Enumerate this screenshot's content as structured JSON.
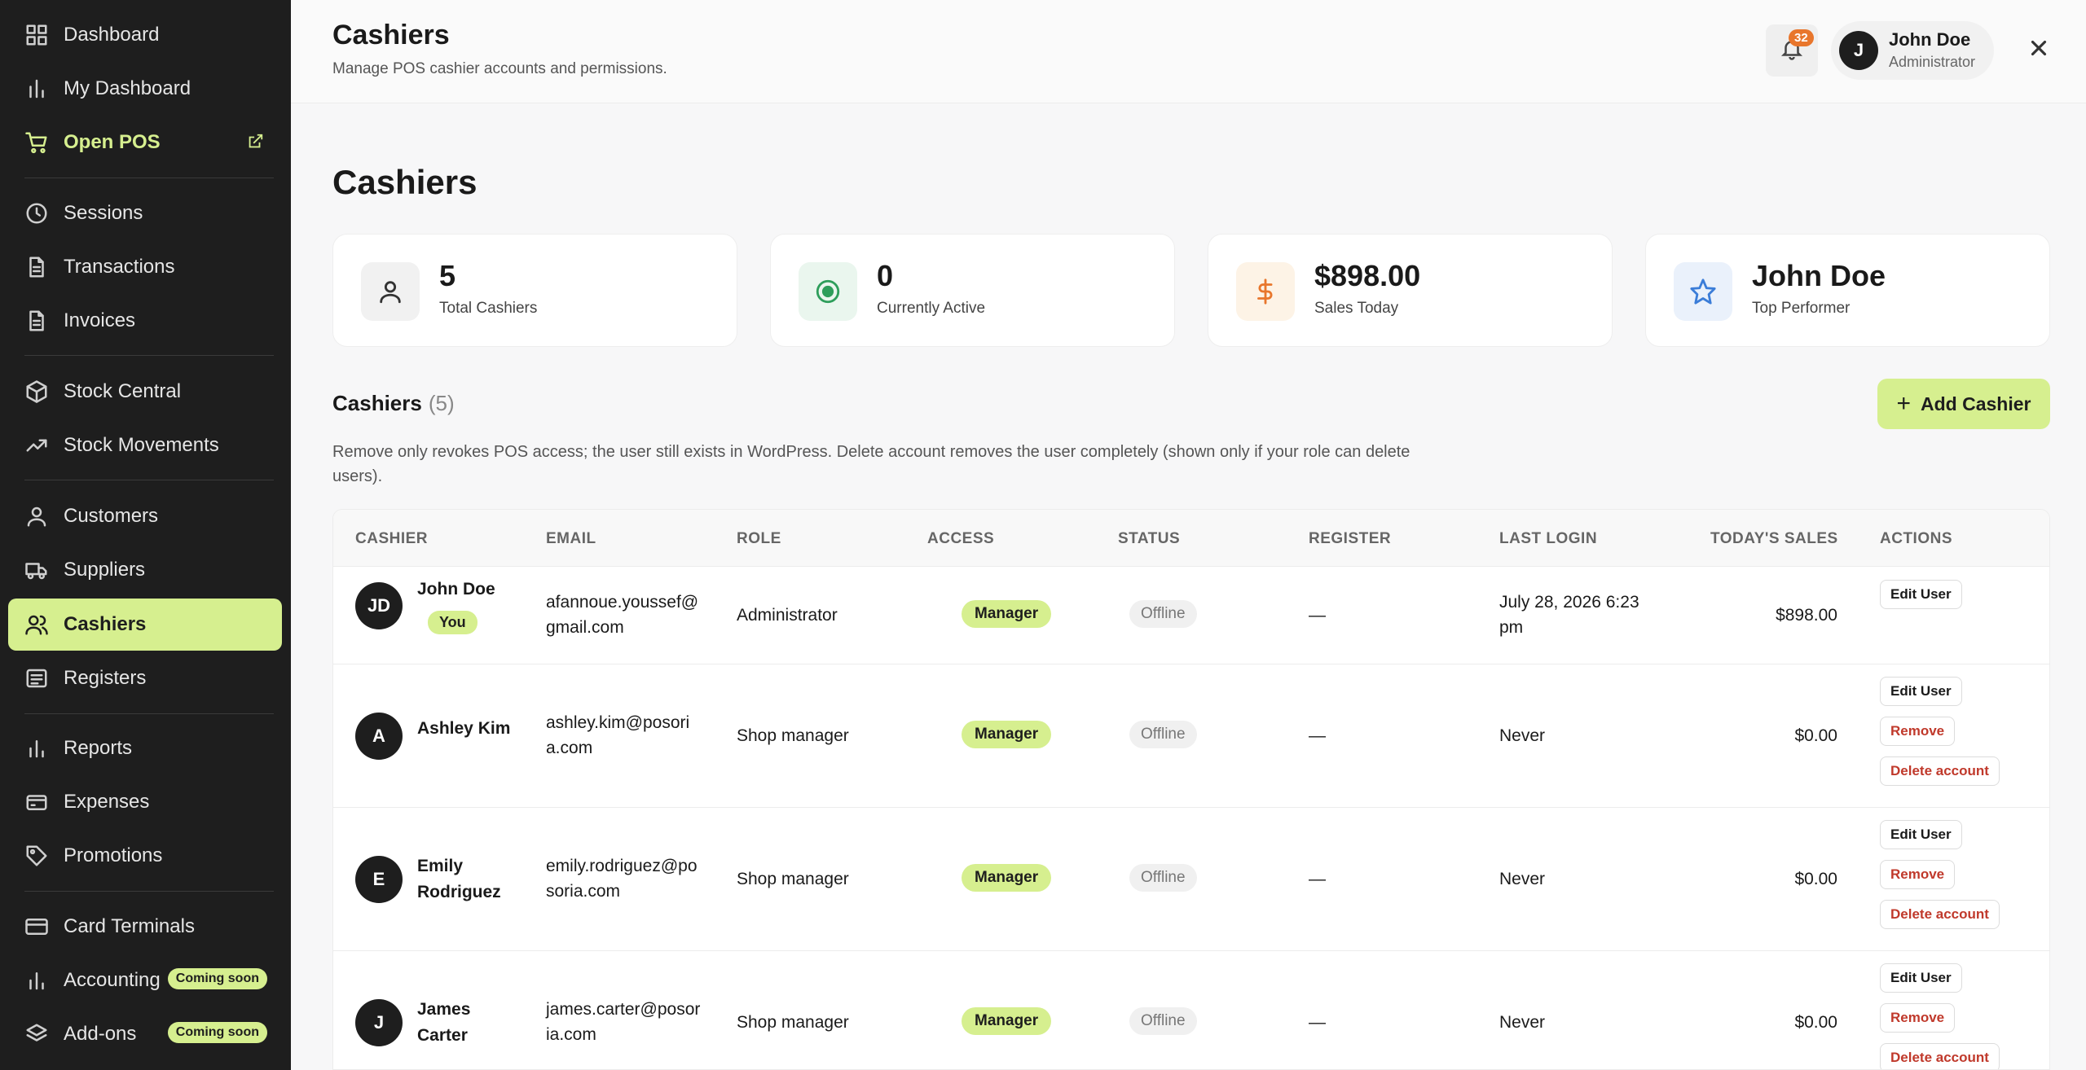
{
  "sidebar": {
    "items": [
      {
        "label": "Dashboard",
        "icon": "grid-icon"
      },
      {
        "label": "My Dashboard",
        "icon": "bar-chart-icon"
      },
      {
        "label": "Open POS",
        "icon": "cart-icon"
      },
      {
        "label": "Sessions",
        "icon": "clock-icon"
      },
      {
        "label": "Transactions",
        "icon": "file-icon"
      },
      {
        "label": "Invoices",
        "icon": "file-icon"
      },
      {
        "label": "Stock Central",
        "icon": "box-icon"
      },
      {
        "label": "Stock Movements",
        "icon": "trending-up-icon"
      },
      {
        "label": "Customers",
        "icon": "user-icon"
      },
      {
        "label": "Suppliers",
        "icon": "truck-icon"
      },
      {
        "label": "Cashiers",
        "icon": "users-icon"
      },
      {
        "label": "Registers",
        "icon": "list-icon"
      },
      {
        "label": "Reports",
        "icon": "bar-chart-icon"
      },
      {
        "label": "Expenses",
        "icon": "wallet-icon"
      },
      {
        "label": "Promotions",
        "icon": "tag-icon"
      },
      {
        "label": "Card Terminals",
        "icon": "credit-card-icon"
      },
      {
        "label": "Accounting",
        "icon": "bar-chart-icon"
      },
      {
        "label": "Add-ons",
        "icon": "layers-icon"
      }
    ],
    "coming_soon": "Coming soon"
  },
  "header": {
    "title": "Cashiers",
    "subtitle": "Manage POS cashier accounts and permissions.",
    "notification_count": "32",
    "user_initial": "J",
    "user_name": "John Doe",
    "user_role": "Administrator"
  },
  "main": {
    "title": "Cashiers",
    "stats": [
      {
        "value": "5",
        "label": "Total Cashiers",
        "icon": "user-icon"
      },
      {
        "value": "0",
        "label": "Currently Active",
        "icon": "target-icon"
      },
      {
        "value": "$898.00",
        "label": "Sales Today",
        "icon": "dollar-icon"
      },
      {
        "value": "John Doe",
        "label": "Top Performer",
        "icon": "star-icon"
      }
    ],
    "section_title": "Cashiers",
    "section_count": "(5)",
    "add_button": "Add Cashier",
    "notice": "Remove only revokes POS access; the user still exists in WordPress. Delete account removes the user completely (shown only if your role can delete users)."
  },
  "table": {
    "headers": [
      "CASHIER",
      "EMAIL",
      "ROLE",
      "ACCESS",
      "STATUS",
      "REGISTER",
      "LAST LOGIN",
      "TODAY'S SALES",
      "ACTIONS"
    ],
    "you_label": "You",
    "edit_label": "Edit User",
    "remove_label": "Remove",
    "delete_label": "Delete account",
    "rows": [
      {
        "initials": "JD",
        "name": "John Doe",
        "email": "afannoue.youssef@gmail.com",
        "role": "Administrator",
        "access": "Manager",
        "status": "Offline",
        "register": "—",
        "last_login": "July 28, 2026 6:23 pm",
        "sales": "$898.00"
      },
      {
        "initials": "A",
        "name": "Ashley Kim",
        "email": "ashley.kim@posoria.com",
        "role": "Shop manager",
        "access": "Manager",
        "status": "Offline",
        "register": "—",
        "last_login": "Never",
        "sales": "$0.00"
      },
      {
        "initials": "E",
        "name": "Emily Rodriguez",
        "email": "emily.rodriguez@posoria.com",
        "role": "Shop manager",
        "access": "Manager",
        "status": "Offline",
        "register": "—",
        "last_login": "Never",
        "sales": "$0.00"
      },
      {
        "initials": "J",
        "name": "James Carter",
        "email": "james.carter@posoria.com",
        "role": "Shop manager",
        "access": "Manager",
        "status": "Offline",
        "register": "—",
        "last_login": "Never",
        "sales": "$0.00"
      }
    ]
  },
  "colors": {
    "accent": "#d6ef8f",
    "sidebar": "#1e1e1e",
    "danger": "#c0392b",
    "badge": "#e8762c"
  }
}
